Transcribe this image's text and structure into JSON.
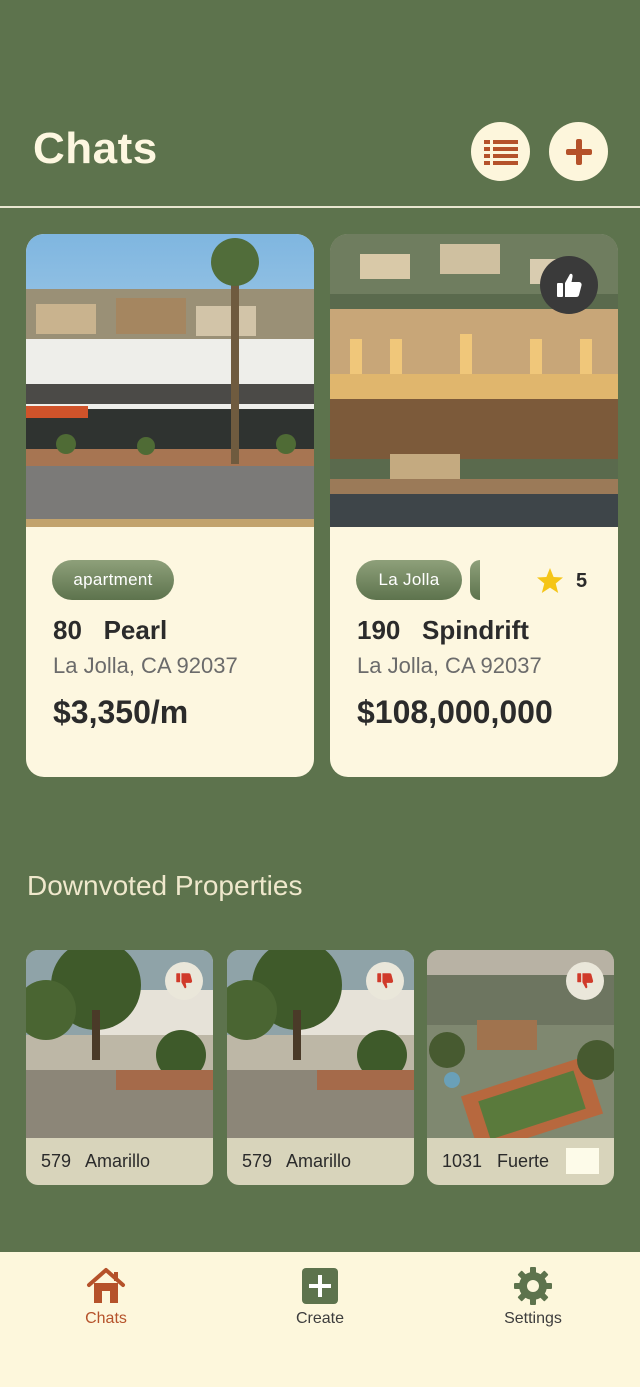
{
  "header": {
    "title": "Chats",
    "list_icon": "list-icon",
    "add_icon": "plus-icon"
  },
  "properties": [
    {
      "tag": "apartment",
      "address": "80   Pearl",
      "city": "La Jolla, CA 92037",
      "price": "$3,350/m"
    },
    {
      "tag": "La Jolla",
      "address": "190   Spindrift",
      "city": "La Jolla, CA 92037",
      "price": "$108,000,000",
      "rating": "5",
      "liked_icon": "thumbs-up-icon"
    }
  ],
  "downvoted": {
    "title": "Downvoted Properties",
    "items": [
      {
        "label": "579   Amarillo"
      },
      {
        "label": "579   Amarillo"
      },
      {
        "label": "1031   Fuerte"
      }
    ]
  },
  "tabbar": {
    "items": [
      {
        "label": "Chats",
        "icon": "home-icon",
        "active": true
      },
      {
        "label": "Create",
        "icon": "plus-square-icon",
        "active": false
      },
      {
        "label": "Settings",
        "icon": "gear-icon",
        "active": false
      }
    ]
  },
  "colors": {
    "background": "#5d734d",
    "accent": "#b5522a",
    "card": "#fdf7e0"
  }
}
